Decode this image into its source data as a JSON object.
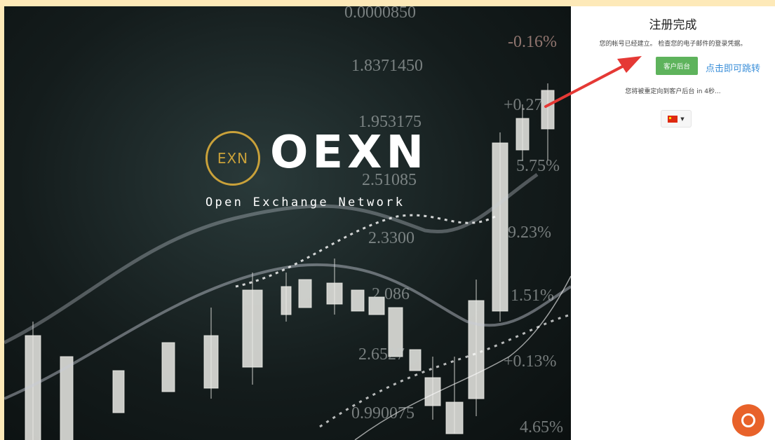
{
  "hero": {
    "logo_mark": "EXN",
    "brand": "OEXN",
    "tagline": "Open Exchange Network",
    "ticker_numbers": [
      "0.0000850",
      "-0.16%",
      "1.8371450",
      "1.953175",
      "+0.27",
      "2.51085",
      "2.3300",
      "9.23%",
      "2.086",
      "1.51%",
      "2.6527",
      "+0.13%",
      "0.990075",
      "5.75%",
      "4.65%"
    ]
  },
  "panel": {
    "title": "注册完成",
    "subtitle": "您的帐号已经建立。 检查您的电子邮件的登录凭据。",
    "portal_button": "客户后台",
    "jump_hint": "点击即可跳转",
    "redirect_text": "您将被重定向到客户后台 in 4秒..."
  },
  "colors": {
    "accent_green": "#5eb35c",
    "link_blue": "#3b8fd9",
    "chat_orange": "#e8622a",
    "arrow_red": "#e53935",
    "gold": "#c9a13a"
  },
  "icons": {
    "language": "china-flag-icon",
    "chat": "chat-bubble-icon"
  }
}
